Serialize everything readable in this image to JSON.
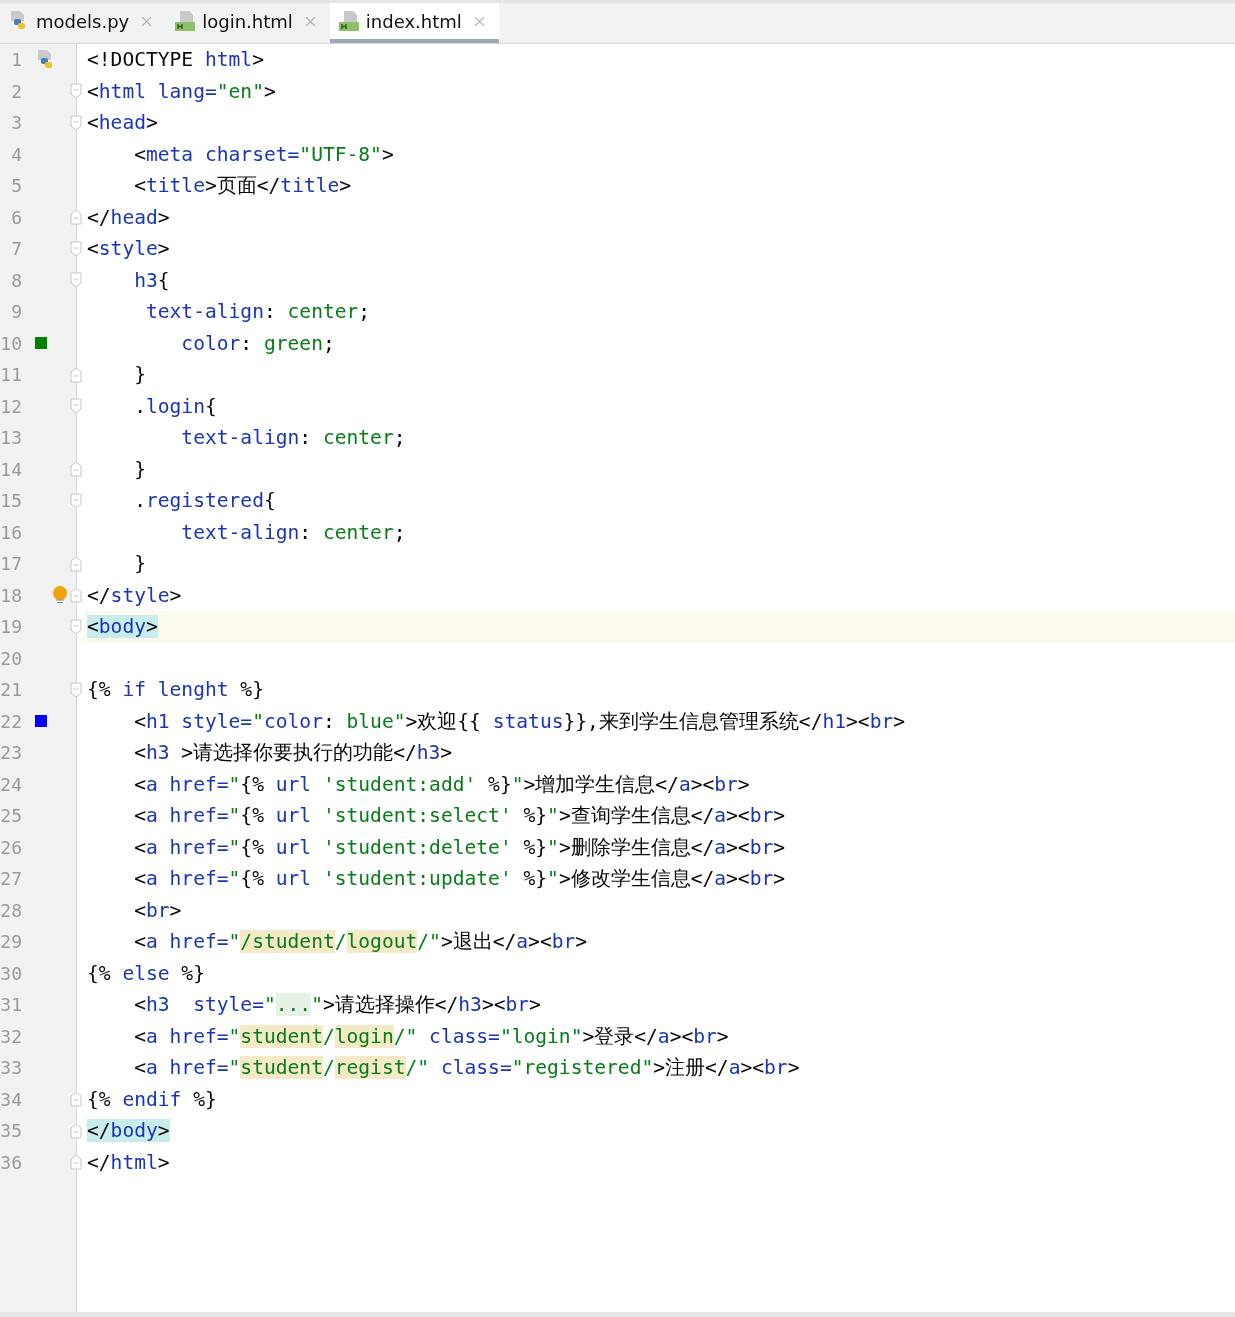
{
  "tabs": [
    {
      "label": "models.py",
      "kind": "python",
      "selected": false
    },
    {
      "label": "login.html",
      "kind": "html",
      "selected": false
    },
    {
      "label": "index.html",
      "kind": "html",
      "selected": true
    }
  ],
  "lines": [
    {
      "number": "1",
      "fold_start": false,
      "fold_end": false,
      "current": false,
      "file_icon": true,
      "tokens": [
        {
          "t": "<!DOCTYPE ",
          "kind": "plain"
        },
        {
          "t": "html",
          "kind": "markup"
        },
        {
          "t": ">",
          "kind": "plain"
        }
      ]
    },
    {
      "number": "2",
      "fold_start": true,
      "fold_end": false,
      "current": false,
      "tokens": [
        {
          "t": "<",
          "kind": "plain"
        },
        {
          "t": "html lang=",
          "kind": "markup"
        },
        {
          "t": "\"en\"",
          "kind": "string"
        },
        {
          "t": ">",
          "kind": "plain"
        }
      ]
    },
    {
      "number": "3",
      "fold_start": true,
      "fold_end": false,
      "current": false,
      "tokens": [
        {
          "t": "<",
          "kind": "plain"
        },
        {
          "t": "head",
          "kind": "markup"
        },
        {
          "t": ">",
          "kind": "plain"
        }
      ]
    },
    {
      "number": "4",
      "fold_start": false,
      "fold_end": false,
      "current": false,
      "tokens": [
        {
          "t": "    <",
          "kind": "plain"
        },
        {
          "t": "meta charset=",
          "kind": "markup"
        },
        {
          "t": "\"UTF-8\"",
          "kind": "string"
        },
        {
          "t": ">",
          "kind": "plain"
        }
      ]
    },
    {
      "number": "5",
      "fold_start": false,
      "fold_end": false,
      "current": false,
      "tokens": [
        {
          "t": "    <",
          "kind": "plain"
        },
        {
          "t": "title",
          "kind": "markup"
        },
        {
          "t": ">页面</",
          "kind": "plain"
        },
        {
          "t": "title",
          "kind": "markup"
        },
        {
          "t": ">",
          "kind": "plain"
        }
      ]
    },
    {
      "number": "6",
      "fold_start": false,
      "fold_end": true,
      "current": false,
      "tokens": [
        {
          "t": "</",
          "kind": "plain"
        },
        {
          "t": "head",
          "kind": "markup"
        },
        {
          "t": ">",
          "kind": "plain"
        }
      ]
    },
    {
      "number": "7",
      "fold_start": true,
      "fold_end": false,
      "current": false,
      "tokens": [
        {
          "t": "<",
          "kind": "plain"
        },
        {
          "t": "style",
          "kind": "markup"
        },
        {
          "t": ">",
          "kind": "plain"
        }
      ]
    },
    {
      "number": "8",
      "fold_start": true,
      "fold_end": false,
      "current": false,
      "tokens": [
        {
          "t": "    h3",
          "kind": "markup"
        },
        {
          "t": "{",
          "kind": "plain"
        }
      ]
    },
    {
      "number": "9",
      "fold_start": false,
      "fold_end": false,
      "current": false,
      "tokens": [
        {
          "t": "     text-align",
          "kind": "markup"
        },
        {
          "t": ": ",
          "kind": "plain"
        },
        {
          "t": "center",
          "kind": "string"
        },
        {
          "t": ";",
          "kind": "plain"
        }
      ]
    },
    {
      "number": "10",
      "fold_start": false,
      "fold_end": false,
      "current": false,
      "marker": {
        "color": "#008000"
      },
      "tokens": [
        {
          "t": "        color",
          "kind": "markup"
        },
        {
          "t": ": ",
          "kind": "plain"
        },
        {
          "t": "green",
          "kind": "string"
        },
        {
          "t": ";",
          "kind": "plain"
        }
      ]
    },
    {
      "number": "11",
      "fold_start": false,
      "fold_end": true,
      "current": false,
      "tokens": [
        {
          "t": "    }",
          "kind": "plain"
        }
      ]
    },
    {
      "number": "12",
      "fold_start": true,
      "fold_end": false,
      "current": false,
      "tokens": [
        {
          "t": "    .",
          "kind": "plain"
        },
        {
          "t": "login",
          "kind": "markup"
        },
        {
          "t": "{",
          "kind": "plain"
        }
      ]
    },
    {
      "number": "13",
      "fold_start": false,
      "fold_end": false,
      "current": false,
      "tokens": [
        {
          "t": "        text-align",
          "kind": "markup"
        },
        {
          "t": ": ",
          "kind": "plain"
        },
        {
          "t": "center",
          "kind": "string"
        },
        {
          "t": ";",
          "kind": "plain"
        }
      ]
    },
    {
      "number": "14",
      "fold_start": false,
      "fold_end": true,
      "current": false,
      "tokens": [
        {
          "t": "    }",
          "kind": "plain"
        }
      ]
    },
    {
      "number": "15",
      "fold_start": true,
      "fold_end": false,
      "current": false,
      "tokens": [
        {
          "t": "    .",
          "kind": "plain"
        },
        {
          "t": "registered",
          "kind": "markup"
        },
        {
          "t": "{",
          "kind": "plain"
        }
      ]
    },
    {
      "number": "16",
      "fold_start": false,
      "fold_end": false,
      "current": false,
      "tokens": [
        {
          "t": "        text-align",
          "kind": "markup"
        },
        {
          "t": ": ",
          "kind": "plain"
        },
        {
          "t": "center",
          "kind": "string"
        },
        {
          "t": ";",
          "kind": "plain"
        }
      ]
    },
    {
      "number": "17",
      "fold_start": false,
      "fold_end": true,
      "current": false,
      "tokens": [
        {
          "t": "    }",
          "kind": "plain"
        }
      ]
    },
    {
      "number": "18",
      "fold_start": false,
      "fold_end": true,
      "current": false,
      "bulb": true,
      "tokens": [
        {
          "t": "</",
          "kind": "plain"
        },
        {
          "t": "style",
          "kind": "markup"
        },
        {
          "t": ">",
          "kind": "plain"
        }
      ]
    },
    {
      "number": "19",
      "fold_start": true,
      "fold_end": false,
      "current": true,
      "tokens": [
        {
          "t": "<",
          "kind": "match-plain"
        },
        {
          "t": "body",
          "kind": "match-markup"
        },
        {
          "t": ">",
          "kind": "match-plain"
        }
      ]
    },
    {
      "number": "20",
      "fold_start": false,
      "fold_end": false,
      "current": false
    },
    {
      "number": "21",
      "fold_start": true,
      "fold_end": false,
      "current": false,
      "tokens": [
        {
          "t": "{% ",
          "kind": "plain"
        },
        {
          "t": "if lenght",
          "kind": "markup"
        },
        {
          "t": " %}",
          "kind": "plain"
        }
      ]
    },
    {
      "number": "22",
      "fold_start": false,
      "fold_end": false,
      "current": false,
      "marker": {
        "color": "#0000ff"
      },
      "tokens": [
        {
          "t": "    <",
          "kind": "plain"
        },
        {
          "t": "h1 style=",
          "kind": "markup"
        },
        {
          "t": "\"",
          "kind": "string"
        },
        {
          "t": "color",
          "kind": "markup"
        },
        {
          "t": ": ",
          "kind": "plain"
        },
        {
          "t": "blue\"",
          "kind": "string"
        },
        {
          "t": ">欢迎{{ ",
          "kind": "plain"
        },
        {
          "t": "status",
          "kind": "markup"
        },
        {
          "t": "}},来到学生信息管理系统</",
          "kind": "plain"
        },
        {
          "t": "h1",
          "kind": "markup"
        },
        {
          "t": "><",
          "kind": "plain"
        },
        {
          "t": "br",
          "kind": "markup"
        },
        {
          "t": ">",
          "kind": "plain"
        }
      ]
    },
    {
      "number": "23",
      "fold_start": false,
      "fold_end": false,
      "current": false,
      "tokens": [
        {
          "t": "    <",
          "kind": "plain"
        },
        {
          "t": "h3",
          "kind": "markup"
        },
        {
          "t": " >请选择你要执行的功能</",
          "kind": "plain"
        },
        {
          "t": "h3",
          "kind": "markup"
        },
        {
          "t": ">",
          "kind": "plain"
        }
      ]
    },
    {
      "number": "24",
      "fold_start": false,
      "fold_end": false,
      "current": false,
      "tokens": [
        {
          "t": "    <",
          "kind": "plain"
        },
        {
          "t": "a href=",
          "kind": "markup"
        },
        {
          "t": "\"",
          "kind": "string"
        },
        {
          "t": "{% ",
          "kind": "plain"
        },
        {
          "t": "url ",
          "kind": "markup"
        },
        {
          "t": "'student:add'",
          "kind": "string"
        },
        {
          "t": " %}",
          "kind": "plain"
        },
        {
          "t": "\"",
          "kind": "string"
        },
        {
          "t": ">增加学生信息</",
          "kind": "plain"
        },
        {
          "t": "a",
          "kind": "markup"
        },
        {
          "t": "><",
          "kind": "plain"
        },
        {
          "t": "br",
          "kind": "markup"
        },
        {
          "t": ">",
          "kind": "plain"
        }
      ]
    },
    {
      "number": "25",
      "fold_start": false,
      "fold_end": false,
      "current": false,
      "tokens": [
        {
          "t": "    <",
          "kind": "plain"
        },
        {
          "t": "a href=",
          "kind": "markup"
        },
        {
          "t": "\"",
          "kind": "string"
        },
        {
          "t": "{% ",
          "kind": "plain"
        },
        {
          "t": "url ",
          "kind": "markup"
        },
        {
          "t": "'student:select'",
          "kind": "string"
        },
        {
          "t": " %}",
          "kind": "plain"
        },
        {
          "t": "\"",
          "kind": "string"
        },
        {
          "t": ">查询学生信息</",
          "kind": "plain"
        },
        {
          "t": "a",
          "kind": "markup"
        },
        {
          "t": "><",
          "kind": "plain"
        },
        {
          "t": "br",
          "kind": "markup"
        },
        {
          "t": ">",
          "kind": "plain"
        }
      ]
    },
    {
      "number": "26",
      "fold_start": false,
      "fold_end": false,
      "current": false,
      "tokens": [
        {
          "t": "    <",
          "kind": "plain"
        },
        {
          "t": "a href=",
          "kind": "markup"
        },
        {
          "t": "\"",
          "kind": "string"
        },
        {
          "t": "{% ",
          "kind": "plain"
        },
        {
          "t": "url ",
          "kind": "markup"
        },
        {
          "t": "'student:delete'",
          "kind": "string"
        },
        {
          "t": " %}",
          "kind": "plain"
        },
        {
          "t": "\"",
          "kind": "string"
        },
        {
          "t": ">删除学生信息</",
          "kind": "plain"
        },
        {
          "t": "a",
          "kind": "markup"
        },
        {
          "t": "><",
          "kind": "plain"
        },
        {
          "t": "br",
          "kind": "markup"
        },
        {
          "t": ">",
          "kind": "plain"
        }
      ]
    },
    {
      "number": "27",
      "fold_start": false,
      "fold_end": false,
      "current": false,
      "tokens": [
        {
          "t": "    <",
          "kind": "plain"
        },
        {
          "t": "a href=",
          "kind": "markup"
        },
        {
          "t": "\"",
          "kind": "string"
        },
        {
          "t": "{% ",
          "kind": "plain"
        },
        {
          "t": "url ",
          "kind": "markup"
        },
        {
          "t": "'student:update'",
          "kind": "string"
        },
        {
          "t": " %}",
          "kind": "plain"
        },
        {
          "t": "\"",
          "kind": "string"
        },
        {
          "t": ">修改学生信息</",
          "kind": "plain"
        },
        {
          "t": "a",
          "kind": "markup"
        },
        {
          "t": "><",
          "kind": "plain"
        },
        {
          "t": "br",
          "kind": "markup"
        },
        {
          "t": ">",
          "kind": "plain"
        }
      ]
    },
    {
      "number": "28",
      "fold_start": false,
      "fold_end": false,
      "current": false,
      "tokens": [
        {
          "t": "    <",
          "kind": "plain"
        },
        {
          "t": "br",
          "kind": "markup"
        },
        {
          "t": ">",
          "kind": "plain"
        }
      ]
    },
    {
      "number": "29",
      "fold_start": false,
      "fold_end": false,
      "current": false,
      "tokens": [
        {
          "t": "    <",
          "kind": "plain"
        },
        {
          "t": "a href=",
          "kind": "markup"
        },
        {
          "t": "\"",
          "kind": "string"
        },
        {
          "t": "/student",
          "kind": "path"
        },
        {
          "t": "/",
          "kind": "string"
        },
        {
          "t": "logout",
          "kind": "path"
        },
        {
          "t": "/\"",
          "kind": "string"
        },
        {
          "t": ">退出</",
          "kind": "plain"
        },
        {
          "t": "a",
          "kind": "markup"
        },
        {
          "t": "><",
          "kind": "plain"
        },
        {
          "t": "br",
          "kind": "markup"
        },
        {
          "t": ">",
          "kind": "plain"
        }
      ]
    },
    {
      "number": "30",
      "fold_start": false,
      "fold_end": false,
      "current": false,
      "tokens": [
        {
          "t": "{% ",
          "kind": "plain"
        },
        {
          "t": "else",
          "kind": "markup"
        },
        {
          "t": " %}",
          "kind": "plain"
        }
      ]
    },
    {
      "number": "31",
      "fold_start": false,
      "fold_end": false,
      "current": false,
      "tokens": [
        {
          "t": "    <",
          "kind": "plain"
        },
        {
          "t": "h3  style=",
          "kind": "markup"
        },
        {
          "t": "\"",
          "kind": "string"
        },
        {
          "t": "...",
          "kind": "folded"
        },
        {
          "t": "\"",
          "kind": "string"
        },
        {
          "t": ">请选择操作</",
          "kind": "plain"
        },
        {
          "t": "h3",
          "kind": "markup"
        },
        {
          "t": "><",
          "kind": "plain"
        },
        {
          "t": "br",
          "kind": "markup"
        },
        {
          "t": ">",
          "kind": "plain"
        }
      ]
    },
    {
      "number": "32",
      "fold_start": false,
      "fold_end": false,
      "current": false,
      "tokens": [
        {
          "t": "    <",
          "kind": "plain"
        },
        {
          "t": "a href=",
          "kind": "markup"
        },
        {
          "t": "\"",
          "kind": "string"
        },
        {
          "t": "student",
          "kind": "path"
        },
        {
          "t": "/",
          "kind": "string"
        },
        {
          "t": "login",
          "kind": "path"
        },
        {
          "t": "/\" ",
          "kind": "string"
        },
        {
          "t": "class=",
          "kind": "markup"
        },
        {
          "t": "\"login\"",
          "kind": "string"
        },
        {
          "t": ">登录</",
          "kind": "plain"
        },
        {
          "t": "a",
          "kind": "markup"
        },
        {
          "t": "><",
          "kind": "plain"
        },
        {
          "t": "br",
          "kind": "markup"
        },
        {
          "t": ">",
          "kind": "plain"
        }
      ]
    },
    {
      "number": "33",
      "fold_start": false,
      "fold_end": false,
      "current": false,
      "tokens": [
        {
          "t": "    <",
          "kind": "plain"
        },
        {
          "t": "a href=",
          "kind": "markup"
        },
        {
          "t": "\"",
          "kind": "string"
        },
        {
          "t": "student",
          "kind": "path"
        },
        {
          "t": "/",
          "kind": "string"
        },
        {
          "t": "regist",
          "kind": "path"
        },
        {
          "t": "/\" ",
          "kind": "string"
        },
        {
          "t": "class=",
          "kind": "markup"
        },
        {
          "t": "\"registered\"",
          "kind": "string"
        },
        {
          "t": ">注册</",
          "kind": "plain"
        },
        {
          "t": "a",
          "kind": "markup"
        },
        {
          "t": "><",
          "kind": "plain"
        },
        {
          "t": "br",
          "kind": "markup"
        },
        {
          "t": ">",
          "kind": "plain"
        }
      ]
    },
    {
      "number": "34",
      "fold_start": false,
      "fold_end": true,
      "current": false,
      "tokens": [
        {
          "t": "{% ",
          "kind": "plain"
        },
        {
          "t": "endif",
          "kind": "markup"
        },
        {
          "t": " %}",
          "kind": "plain"
        }
      ]
    },
    {
      "number": "35",
      "fold_start": false,
      "fold_end": true,
      "current": false,
      "tokens": [
        {
          "t": "</",
          "kind": "match-plain"
        },
        {
          "t": "body",
          "kind": "match-markup"
        },
        {
          "t": ">",
          "kind": "match-plain"
        }
      ]
    },
    {
      "number": "36",
      "fold_start": false,
      "fold_end": true,
      "current": false,
      "tokens": [
        {
          "t": "</",
          "kind": "plain"
        },
        {
          "t": "html",
          "kind": "markup"
        },
        {
          "t": ">",
          "kind": "plain"
        }
      ]
    }
  ]
}
